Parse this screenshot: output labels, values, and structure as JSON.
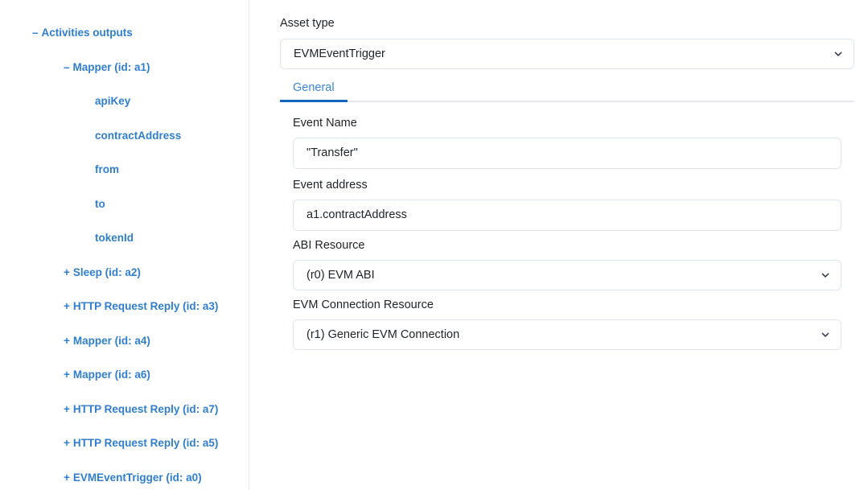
{
  "sidebar": {
    "items": [
      {
        "twisty": "–",
        "label": "Activities outputs",
        "depth": 0
      },
      {
        "twisty": "–",
        "label": "Mapper (id: a1)",
        "depth": 1
      },
      {
        "twisty": "",
        "label": "apiKey",
        "depth": 2
      },
      {
        "twisty": "",
        "label": "contractAddress",
        "depth": 2
      },
      {
        "twisty": "",
        "label": "from",
        "depth": 2
      },
      {
        "twisty": "",
        "label": "to",
        "depth": 2
      },
      {
        "twisty": "",
        "label": "tokenId",
        "depth": 2
      },
      {
        "twisty": "+",
        "label": "Sleep (id: a2)",
        "depth": 1
      },
      {
        "twisty": "+",
        "label": "HTTP Request Reply (id: a3)",
        "depth": 1
      },
      {
        "twisty": "+",
        "label": "Mapper (id: a4)",
        "depth": 1
      },
      {
        "twisty": "+",
        "label": "Mapper (id: a6)",
        "depth": 1
      },
      {
        "twisty": "+",
        "label": "HTTP Request Reply (id: a7)",
        "depth": 1
      },
      {
        "twisty": "+",
        "label": "HTTP Request Reply (id: a5)",
        "depth": 1
      },
      {
        "twisty": "+",
        "label": "EVMEventTrigger (id: a0)",
        "depth": 1
      }
    ]
  },
  "main": {
    "asset_type": {
      "label": "Asset type",
      "value": "EVMEventTrigger",
      "icon": "chevron-down-icon"
    },
    "tabs": [
      {
        "label": "General",
        "active": true
      }
    ],
    "fields": [
      {
        "label": "Event Name",
        "value": "\"Transfer\"",
        "control": "text"
      },
      {
        "label": "Event address",
        "value": "a1.contractAddress",
        "control": "text"
      },
      {
        "label": "ABI Resource",
        "value": "(r0) EVM ABI",
        "control": "select",
        "icon": "chevron-down-icon"
      },
      {
        "label": "EVM Connection Resource",
        "value": "(r1) Generic EVM Connection",
        "control": "select",
        "icon": "chevron-down-icon"
      }
    ]
  },
  "colors": {
    "tree_blue": "#2f7ed0",
    "tab_blue": "#3d85d8",
    "tab_underline": "#1565c0",
    "border": "#dee5ee",
    "text": "#212529"
  }
}
